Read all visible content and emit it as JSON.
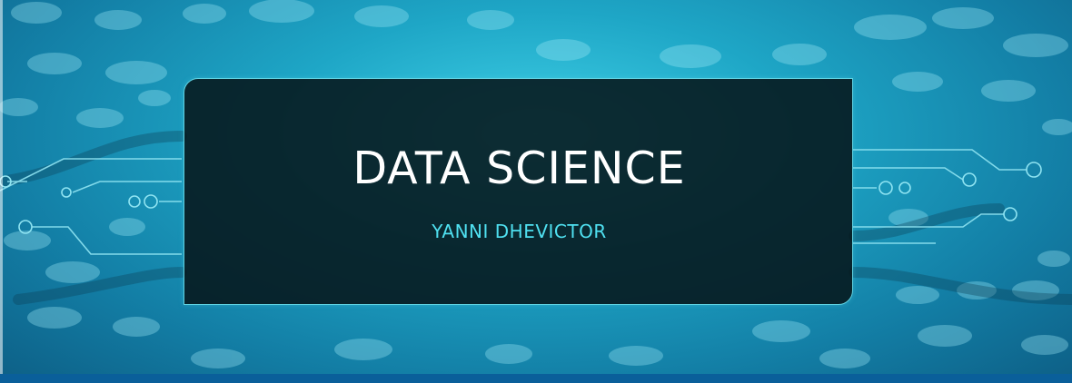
{
  "slide": {
    "title": "DATA SCIENCE",
    "subtitle": "YANNI DHEVICTOR",
    "background_icon": "circuit-board-background"
  },
  "colors": {
    "background_light": "#3fd0e6",
    "background_dark": "#0d5f86",
    "panel_fill": "#06161a",
    "panel_border": "#5fd2e2",
    "title": "#ffffff",
    "subtitle": "#4fe0f0",
    "bottom_bar": "#0a5f9a"
  }
}
